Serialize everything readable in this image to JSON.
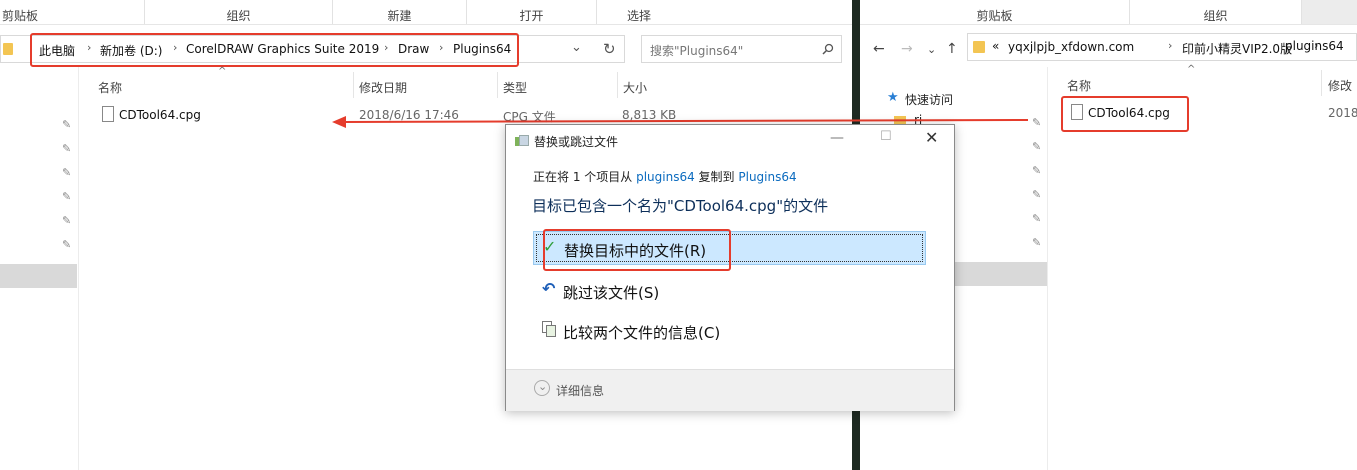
{
  "left": {
    "ribbon_groups": [
      "剪贴板",
      "组织",
      "新建",
      "打开",
      "选择"
    ],
    "breadcrumb": [
      "此电脑",
      "新加卷 (D:)",
      "CorelDRAW Graphics Suite 2019",
      "Draw",
      "Plugins64"
    ],
    "search_placeholder": "搜索\"Plugins64\"",
    "columns": [
      "名称",
      "修改日期",
      "类型",
      "大小"
    ],
    "file": {
      "name": "CDTool64.cpg",
      "date": "2018/6/16 17:46",
      "type": "CPG 文件",
      "size": "8,813 KB"
    }
  },
  "right": {
    "ribbon_groups": [
      "剪贴板",
      "组织"
    ],
    "breadcrumb_prefix": "«",
    "breadcrumb": [
      "yqxjlpjb_xfdown.com",
      "印前小精灵VIP2.0版",
      "plugins64"
    ],
    "quick_access": "快速访问",
    "partial_folder": "ri",
    "columns": [
      "名称",
      "修改"
    ],
    "file": {
      "name": "CDTool64.cpg",
      "date": "2018,"
    }
  },
  "dialog": {
    "title": "替换或跳过文件",
    "info": {
      "prefix": "正在将 1 个项目从 ",
      "source": "plugins64",
      "mid": " 复制到 ",
      "dest": "Plugins64"
    },
    "heading": "目标已包含一个名为\"CDTool64.cpg\"的文件",
    "options": [
      "替换目标中的文件(R)",
      "跳过该文件(S)",
      "比较两个文件的信息(C)"
    ],
    "details": "详细信息"
  },
  "colors": {
    "accent": "#0b6bbf",
    "highlight": "#e53c2c",
    "selected_bg": "#cce8ff"
  }
}
